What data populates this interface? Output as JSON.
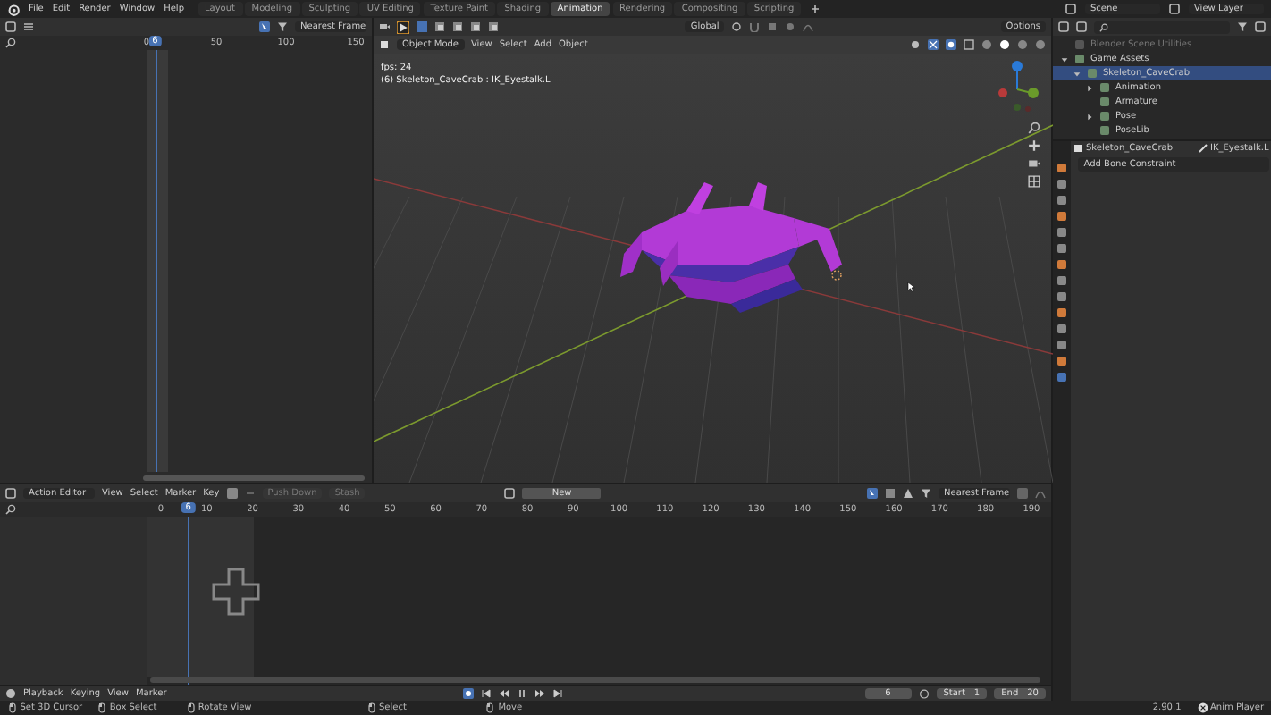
{
  "menu": [
    "File",
    "Edit",
    "Render",
    "Window",
    "Help"
  ],
  "workspaces": [
    {
      "label": "Layout",
      "selected": false
    },
    {
      "label": "Modeling",
      "selected": false
    },
    {
      "label": "Sculpting",
      "selected": false
    },
    {
      "label": "UV Editing",
      "selected": false
    },
    {
      "label": "Texture Paint",
      "selected": false
    },
    {
      "label": "Shading",
      "selected": false
    },
    {
      "label": "Animation",
      "selected": true
    },
    {
      "label": "Rendering",
      "selected": false
    },
    {
      "label": "Compositing",
      "selected": false
    },
    {
      "label": "Scripting",
      "selected": false
    }
  ],
  "scene": "Scene",
  "view_layer": "View Layer",
  "dope_sheet": {
    "snap": "Nearest Frame",
    "ruler": [
      "0",
      "50",
      "100",
      "150"
    ],
    "current_frame": "6"
  },
  "viewport": {
    "orientation": "Global",
    "options": "Options",
    "mode": "Object Mode",
    "menu": [
      "View",
      "Select",
      "Add",
      "Object"
    ],
    "overlay_lines": [
      "fps: 24",
      "(6) Skeleton_CaveCrab : IK_Eyestalk.L"
    ]
  },
  "outliner": {
    "items": [
      {
        "label": "Blender Scene Utilities",
        "excluded": true,
        "selected": false
      },
      {
        "label": "Game Assets",
        "expanded": true,
        "excluded": false,
        "selected": false,
        "children": [
          {
            "label": "Skeleton_CaveCrab",
            "expanded": true,
            "excluded": false,
            "selected": true,
            "children": [
              {
                "label": "Animation",
                "expanded": false,
                "excluded": false,
                "selected": false
              },
              {
                "label": "Armature",
                "excluded": false,
                "selected": false
              },
              {
                "label": "Pose",
                "expanded": false,
                "excluded": false,
                "selected": false
              },
              {
                "label": "PoseLib",
                "excluded": false,
                "selected": false
              }
            ]
          }
        ]
      }
    ]
  },
  "properties": {
    "object": "Skeleton_CaveCrab",
    "bone": "IK_Eyestalk.L",
    "add_constraint": "Add Bone Constraint"
  },
  "action_editor": {
    "mode": "Action Editor",
    "menu": [
      "View",
      "Select",
      "Marker",
      "Key"
    ],
    "push_down": "Push Down",
    "stash": "Stash",
    "new": "New",
    "snap": "Nearest Frame",
    "ruler": [
      "0",
      "10",
      "20",
      "30",
      "40",
      "50",
      "60",
      "70",
      "80",
      "90",
      "100",
      "110",
      "120",
      "130",
      "140",
      "150",
      "160",
      "170",
      "180",
      "190"
    ],
    "current_frame": "6"
  },
  "timeline": {
    "menu": [
      "Playback",
      "Keying",
      "View",
      "Marker"
    ],
    "frame": "6",
    "start_label": "Start",
    "start": "1",
    "end_label": "End",
    "end": "20"
  },
  "status_bar": {
    "hints": [
      "Set 3D Cursor",
      "Box Select",
      "Rotate View",
      "Select",
      "Move"
    ],
    "version": "2.90.1",
    "app": "Anim Player"
  }
}
